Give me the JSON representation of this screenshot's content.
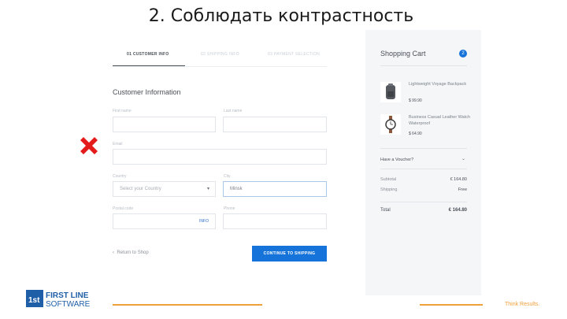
{
  "slide": {
    "title": "2. Соблюдать контрастность"
  },
  "steps": [
    {
      "label": "01 CUSTOMER INFO"
    },
    {
      "label": "02 SHIPPING INFO"
    },
    {
      "label": "03 PAYMENT SELECTION"
    }
  ],
  "form": {
    "section_title": "Customer Information",
    "labels": {
      "first_name": "First name",
      "last_name": "Last name",
      "email": "Email",
      "country": "Country",
      "city": "City",
      "postal": "Postal code",
      "phone": "Phone"
    },
    "values": {
      "country": "Select your Country",
      "city": "Minsk",
      "postal_hint": "INFO"
    },
    "return_link": "Return to Shop",
    "continue_button": "CONTINUE TO SHIPPING"
  },
  "cart": {
    "title": "Shopping Cart",
    "count": "2",
    "items": [
      {
        "name": "Lightweight Voyage Backpack",
        "price": "$ 99.90"
      },
      {
        "name": "Business Casual Leather Watch Waterproof",
        "price": "$ 64.90"
      }
    ],
    "voucher_label": "Have a Voucher?",
    "subtotal_label": "Subtotal",
    "subtotal_value": "€ 164.80",
    "shipping_label": "Shipping",
    "shipping_value": "Free",
    "total_label": "Total",
    "total_value": "€ 164.80"
  },
  "footer": {
    "logo_text_1": "FIRST LINE",
    "logo_text_2": "SOFTWARE",
    "logo_mark": "1st",
    "tagline": "Think Results."
  },
  "colors": {
    "accent": "#1673d9",
    "footer_orange": "#f0a03a",
    "error_red": "#e31b1b"
  }
}
